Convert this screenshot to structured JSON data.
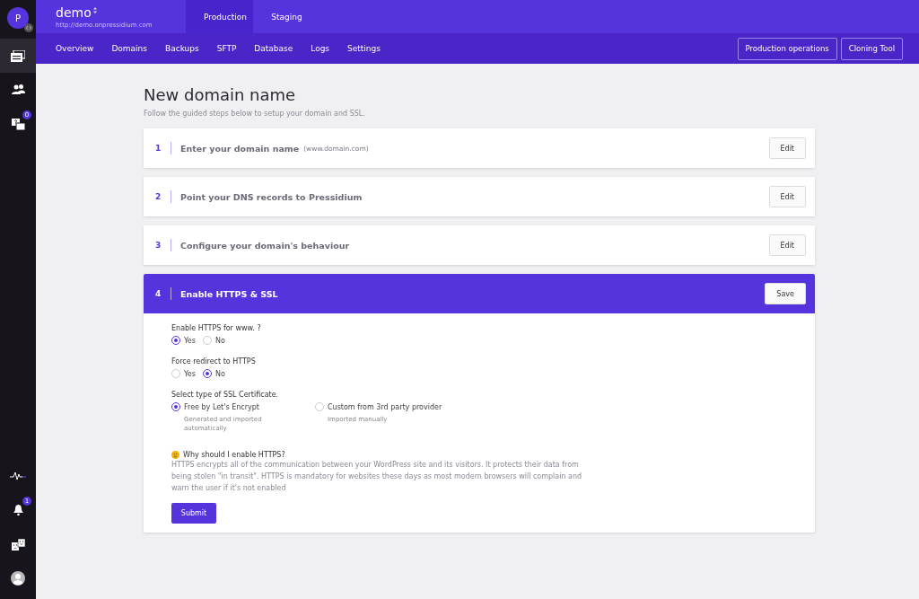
{
  "sidebar": {
    "avatar": "P",
    "items": [
      {
        "kind": "sites",
        "selected": true
      },
      {
        "kind": "team",
        "selected": false
      },
      {
        "kind": "support",
        "selected": false,
        "badge": "0"
      }
    ],
    "bottom": [
      {
        "kind": "activity"
      },
      {
        "kind": "notifications",
        "badge": "1"
      },
      {
        "kind": "feedback"
      },
      {
        "kind": "account"
      }
    ]
  },
  "header": {
    "site_name": "demo",
    "site_url": "http://demo.onpressidium.com",
    "env_tabs": [
      {
        "label": "Production",
        "selected": true
      },
      {
        "label": "Staging",
        "selected": false
      }
    ],
    "nav": [
      "Overview",
      "Domains",
      "Backups",
      "SFTP",
      "Database",
      "Logs",
      "Settings"
    ],
    "actions": [
      "Production operations",
      "Cloning Tool"
    ]
  },
  "page": {
    "title": "New domain name",
    "subtitle": "Follow the guided steps below to setup your domain and SSL.",
    "steps": [
      {
        "number": "1",
        "title": "Enter your domain name",
        "hint": "(www.domain.com)",
        "button": "Edit",
        "expanded": false
      },
      {
        "number": "2",
        "title": "Point your DNS records to Pressidium",
        "button": "Edit",
        "expanded": false
      },
      {
        "number": "3",
        "title": "Configure your domain's behaviour",
        "button": "Edit",
        "expanded": false
      },
      {
        "number": "4",
        "title": "Enable HTTPS & SSL",
        "button": "Save",
        "expanded": true
      }
    ],
    "form": {
      "questions": [
        {
          "label": "Enable HTTPS for www. ?",
          "options": [
            {
              "label": "Yes",
              "selected": true
            },
            {
              "label": "No",
              "selected": false
            }
          ]
        },
        {
          "label": "Force redirect to HTTPS",
          "options": [
            {
              "label": "Yes",
              "selected": false
            },
            {
              "label": "No",
              "selected": true
            }
          ]
        }
      ],
      "certificate": {
        "label": "Select type of SSL Certificate.",
        "options": [
          {
            "label": "Free by Let's Encrypt",
            "note": "Generated and imported automatically",
            "selected": true
          },
          {
            "label": "Custom from 3rd party provider",
            "note": "Imported manually",
            "selected": false
          }
        ]
      },
      "info": {
        "title": "Why should I enable HTTPS?",
        "text": "HTTPS encrypts all of the communication between your WordPress site and its visitors. It protects their data from being stolen \"in transit\". HTTPS is mandatory for websites these days as most modern browsers will complain and warn the user if it's not enabled"
      },
      "submit": "Submit"
    }
  }
}
